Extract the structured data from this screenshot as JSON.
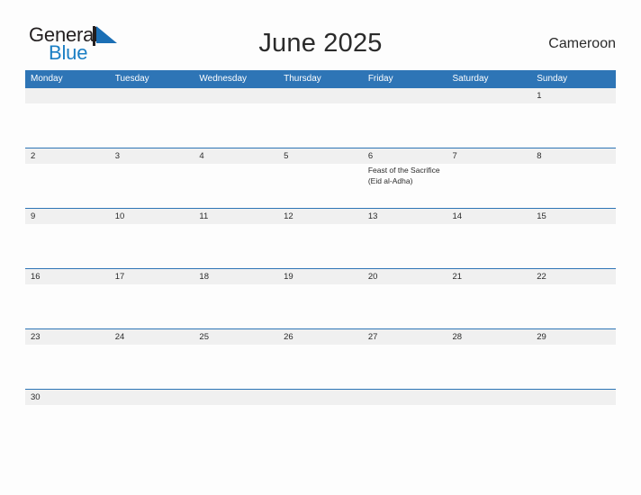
{
  "brand": {
    "word_one": "General",
    "word_two": "Blue",
    "flag_icon": "flag-triangle-icon",
    "color_dark": "#231f20",
    "color_blue": "#1b7fc4"
  },
  "header": {
    "title": "June 2025",
    "country": "Cameroon"
  },
  "theme": {
    "header_blue": "#2e75b6",
    "row_separator": "#2e75b6",
    "date_band": "#f0f0f0",
    "page_background": "#fdfdfd",
    "text": "#2b2b2b"
  },
  "weekdays": [
    "Monday",
    "Tuesday",
    "Wednesday",
    "Thursday",
    "Friday",
    "Saturday",
    "Sunday"
  ],
  "weeks": [
    [
      {
        "date": "",
        "event": ""
      },
      {
        "date": "",
        "event": ""
      },
      {
        "date": "",
        "event": ""
      },
      {
        "date": "",
        "event": ""
      },
      {
        "date": "",
        "event": ""
      },
      {
        "date": "",
        "event": ""
      },
      {
        "date": "1",
        "event": ""
      }
    ],
    [
      {
        "date": "2",
        "event": ""
      },
      {
        "date": "3",
        "event": ""
      },
      {
        "date": "4",
        "event": ""
      },
      {
        "date": "5",
        "event": ""
      },
      {
        "date": "6",
        "event": "Feast of the Sacrifice (Eid al-Adha)"
      },
      {
        "date": "7",
        "event": ""
      },
      {
        "date": "8",
        "event": ""
      }
    ],
    [
      {
        "date": "9",
        "event": ""
      },
      {
        "date": "10",
        "event": ""
      },
      {
        "date": "11",
        "event": ""
      },
      {
        "date": "12",
        "event": ""
      },
      {
        "date": "13",
        "event": ""
      },
      {
        "date": "14",
        "event": ""
      },
      {
        "date": "15",
        "event": ""
      }
    ],
    [
      {
        "date": "16",
        "event": ""
      },
      {
        "date": "17",
        "event": ""
      },
      {
        "date": "18",
        "event": ""
      },
      {
        "date": "19",
        "event": ""
      },
      {
        "date": "20",
        "event": ""
      },
      {
        "date": "21",
        "event": ""
      },
      {
        "date": "22",
        "event": ""
      }
    ],
    [
      {
        "date": "23",
        "event": ""
      },
      {
        "date": "24",
        "event": ""
      },
      {
        "date": "25",
        "event": ""
      },
      {
        "date": "26",
        "event": ""
      },
      {
        "date": "27",
        "event": ""
      },
      {
        "date": "28",
        "event": ""
      },
      {
        "date": "29",
        "event": ""
      }
    ],
    [
      {
        "date": "30",
        "event": ""
      },
      {
        "date": "",
        "event": ""
      },
      {
        "date": "",
        "event": ""
      },
      {
        "date": "",
        "event": ""
      },
      {
        "date": "",
        "event": ""
      },
      {
        "date": "",
        "event": ""
      },
      {
        "date": "",
        "event": ""
      }
    ]
  ]
}
